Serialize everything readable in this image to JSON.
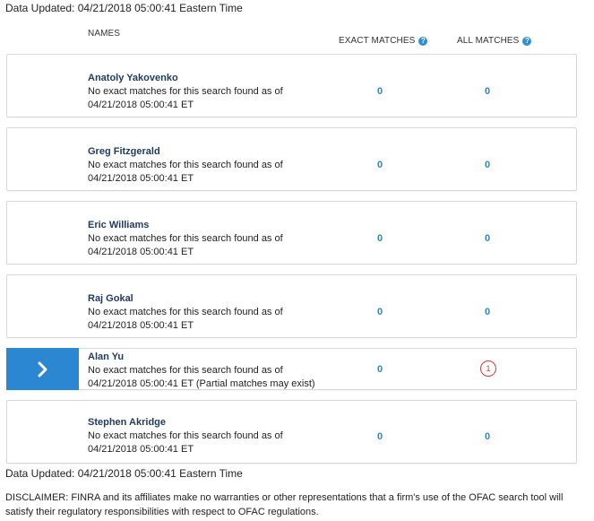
{
  "data_updated": "Data Updated: 04/21/2018 05:00:41 Eastern Time",
  "headers": {
    "names": "NAMES",
    "exact": "EXACT MATCHES",
    "all": "ALL MATCHES",
    "help_glyph": "?"
  },
  "arrow_glyph": "›",
  "rows": [
    {
      "name": "Anatoly Yakovenko",
      "line1": "No exact matches for this search found as of",
      "line2": "04/21/2018 05:00:41 ET",
      "exact": "0",
      "all": "0"
    },
    {
      "name": "Greg Fitzgerald",
      "line1": "No exact matches for this search found as of",
      "line2": "04/21/2018 05:00:41 ET",
      "exact": "0",
      "all": "0"
    },
    {
      "name": "Eric Williams",
      "line1": "No exact matches for this search found as of",
      "line2": "04/21/2018 05:00:41 ET",
      "exact": "0",
      "all": "0"
    },
    {
      "name": "Raj Gokal",
      "line1": "No exact matches for this search found as of",
      "line2": "04/21/2018 05:00:41 ET",
      "exact": "0",
      "all": "0"
    },
    {
      "name": "Alan Yu",
      "line1": "No exact matches for this search found as of",
      "line2": "04/21/2018 05:00:41 ET (Partial matches may exist)",
      "exact": "0",
      "all": "1"
    },
    {
      "name": "Stephen Akridge",
      "line1": "No exact matches for this search found as of",
      "line2": "04/21/2018 05:00:41 ET",
      "exact": "0",
      "all": "0"
    }
  ],
  "disclaimer": "DISCLAIMER: FINRA and its affiliates make no warranties or other representations that a firm's use of the OFAC search tool will satisfy their regulatory responsibilities with respect to OFAC regulations.",
  "colors": {
    "accent": "#2b87d1",
    "alert": "#d43b3b",
    "name": "#1f3a5f"
  }
}
